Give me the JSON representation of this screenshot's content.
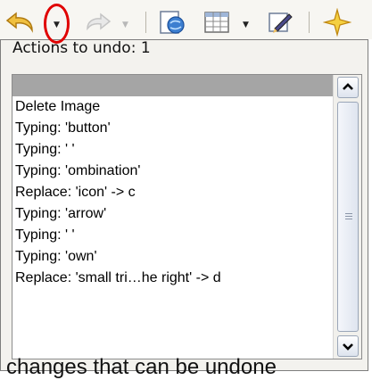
{
  "popup": {
    "title": "Actions to undo: 1",
    "items": [
      {
        "label": "",
        "selected": true
      },
      {
        "label": "Delete Image"
      },
      {
        "label": "Typing: 'button'"
      },
      {
        "label": "Typing: ' '"
      },
      {
        "label": "Typing: 'ombination'"
      },
      {
        "label": "Replace: 'icon' -> c"
      },
      {
        "label": "Typing: 'arrow'"
      },
      {
        "label": "Typing: ' '"
      },
      {
        "label": "Typing: 'own'"
      },
      {
        "label": "Replace: 'small tri…he right' -> d"
      }
    ]
  },
  "document": {
    "partial_text": "changes that can be undone"
  },
  "toolbar": {
    "icons": [
      "undo-icon",
      "redo-icon",
      "navigator-icon",
      "table-icon",
      "draw-functions-icon",
      "gallery-icon"
    ]
  },
  "colors": {
    "highlight_ring": "#e00000",
    "selected_row": "#a5a5a5"
  }
}
